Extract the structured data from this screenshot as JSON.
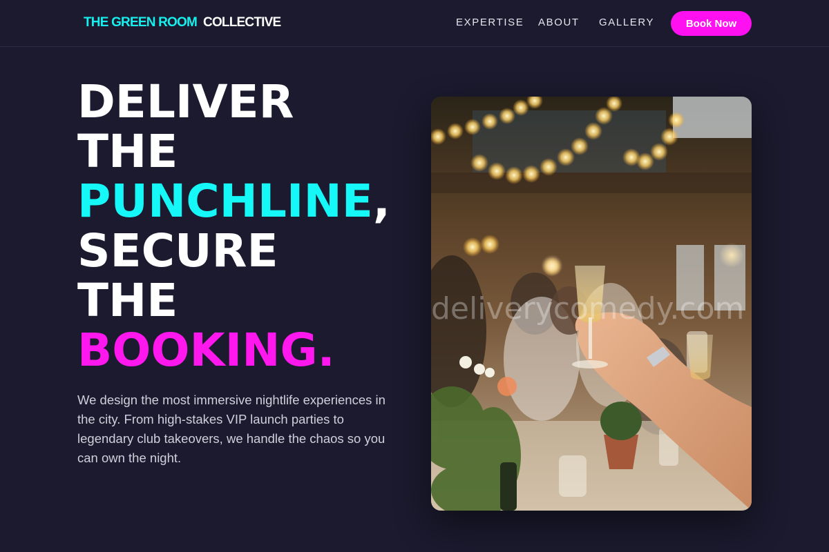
{
  "brand": {
    "part1": "THE GREEN ROOM",
    "part2": "COLLECTIVE"
  },
  "nav": {
    "links": [
      "EXPERTISE",
      "ABOUT",
      "GALLERY"
    ],
    "cta": "Book Now"
  },
  "hero": {
    "lines": [
      {
        "text": "DELIVER",
        "color": "white"
      },
      {
        "text": "THE",
        "color": "white"
      },
      {
        "text": "PUNCHLINE",
        "color": "cyan",
        "suffix": ","
      },
      {
        "text": "SECURE",
        "color": "white"
      },
      {
        "text": "THE",
        "color": "white"
      },
      {
        "text": "BOOKING.",
        "color": "magenta"
      }
    ],
    "description": "We design the most immersive nightlife experiences in the city. From high-stakes VIP launch parties to legendary club takeovers, we handle the chaos so you can own the night.",
    "image_watermark": "deliverycomedy.com"
  },
  "colors": {
    "background": "#1b1a2e",
    "accent_cyan": "#16f7f7",
    "accent_magenta": "#ff18ee"
  }
}
